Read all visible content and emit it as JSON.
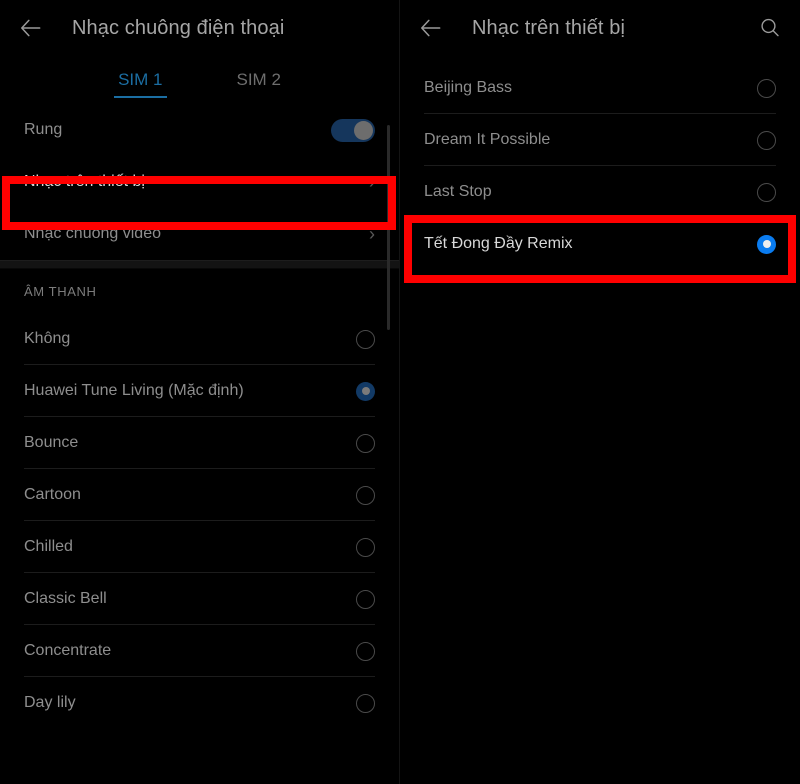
{
  "left_panel": {
    "back_icon": "arrow-left-icon",
    "title": "Nhạc chuông điện thoại",
    "tabs": [
      {
        "label": "SIM 1",
        "active": true
      },
      {
        "label": "SIM 2",
        "active": false
      }
    ],
    "vibrate_row": {
      "label": "Rung",
      "toggle_on": true
    },
    "nav_rows": [
      {
        "label": "Nhạc trên thiết bị",
        "chevron": "chevron-right-icon",
        "highlighted": true
      },
      {
        "label": "Nhạc chuông video",
        "chevron": "chevron-right-icon",
        "highlighted": false
      }
    ],
    "section_header": "ÂM THANH",
    "sound_items": [
      {
        "label": "Không",
        "selected": false
      },
      {
        "label": "Huawei Tune Living (Mặc định)",
        "selected": true
      },
      {
        "label": "Bounce",
        "selected": false
      },
      {
        "label": "Cartoon",
        "selected": false
      },
      {
        "label": "Chilled",
        "selected": false
      },
      {
        "label": "Classic Bell",
        "selected": false
      },
      {
        "label": "Concentrate",
        "selected": false
      },
      {
        "label": "Day lily",
        "selected": false
      }
    ]
  },
  "right_panel": {
    "back_icon": "arrow-left-icon",
    "title": "Nhạc trên thiết bị",
    "search_icon": "search-icon",
    "items": [
      {
        "label": "Beijing Bass",
        "selected": false,
        "highlighted": false
      },
      {
        "label": "Dream It Possible",
        "selected": false,
        "highlighted": false
      },
      {
        "label": "Last Stop",
        "selected": false,
        "highlighted": false
      },
      {
        "label": "Tết Đong Đầy Remix",
        "selected": true,
        "highlighted": true
      }
    ]
  },
  "colors": {
    "background": "#000000",
    "accent_blue": "#0a7cf0",
    "tab_blue": "#1b6ea3",
    "annotation_red": "#ff0000",
    "text_primary": "#b8b8b8",
    "text_secondary": "#8e8e8e"
  }
}
